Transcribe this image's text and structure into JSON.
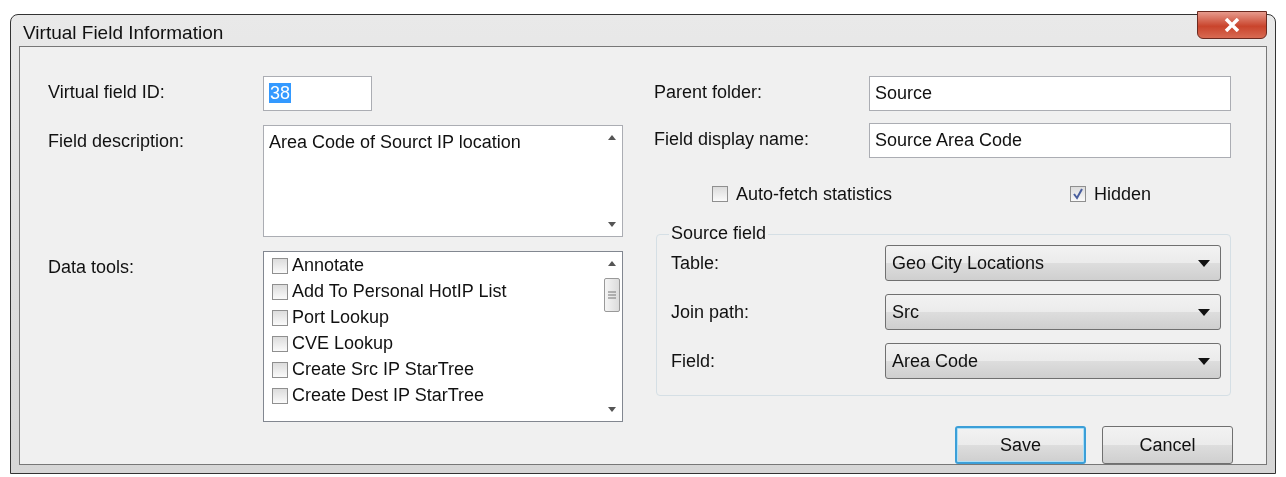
{
  "window": {
    "title": "Virtual Field Information"
  },
  "left": {
    "id_label": "Virtual field ID:",
    "id_value": "38",
    "id_selected": true,
    "description_label": "Field description:",
    "description_value": "Area Code of Sourct IP location",
    "data_tools_label": "Data tools:",
    "data_tools": [
      {
        "label": "Annotate",
        "checked": false
      },
      {
        "label": "Add To Personal HotIP List",
        "checked": false
      },
      {
        "label": "Port Lookup",
        "checked": false
      },
      {
        "label": "CVE Lookup",
        "checked": false
      },
      {
        "label": "Create Src IP StarTree",
        "checked": false
      },
      {
        "label": "Create Dest IP StarTree",
        "checked": false
      }
    ]
  },
  "right": {
    "parent_folder_label": "Parent folder:",
    "parent_folder_value": "Source",
    "display_name_label": "Field display name:",
    "display_name_value": "Source Area Code",
    "options": [
      {
        "label": "Auto-fetch statistics",
        "checked": false
      },
      {
        "label": "Hidden",
        "checked": true
      }
    ],
    "source_field": {
      "title": "Source field",
      "rows": [
        {
          "label": "Table:",
          "value": "Geo City Locations"
        },
        {
          "label": "Join path:",
          "value": "Src"
        },
        {
          "label": "Field:",
          "value": "Area Code"
        }
      ]
    }
  },
  "buttons": [
    {
      "label": "Save",
      "default": true
    },
    {
      "label": "Cancel",
      "default": false
    }
  ]
}
